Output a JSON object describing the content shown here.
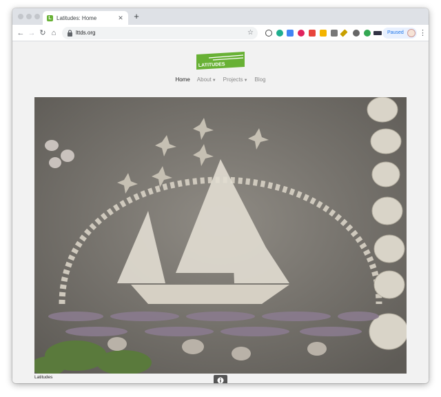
{
  "browser": {
    "tab_title": "Latitudes: Home",
    "tab_favicon_letter": "L",
    "new_tab_label": "+",
    "url": "lttds.org",
    "profile_label": "Paused"
  },
  "site": {
    "logo_text": "LATITUDES",
    "nav": [
      {
        "label": "Home",
        "active": true
      },
      {
        "label": "About",
        "dropdown": true
      },
      {
        "label": "Projects",
        "dropdown": true
      },
      {
        "label": "Blog"
      }
    ],
    "caption": "Latitudes"
  },
  "colors": {
    "accent_green": "#68b135",
    "photo_base": "#7a7670"
  },
  "icons": {
    "info": "info-icon",
    "lock": "lock-icon",
    "star": "star-icon"
  }
}
